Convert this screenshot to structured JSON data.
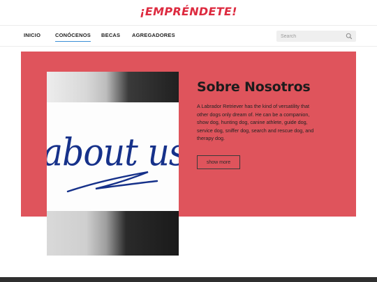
{
  "brand": {
    "logo_text": "¡EMPRÉNDETE!"
  },
  "colors": {
    "accent": "#dd2a3f",
    "hero_bg": "#df545c",
    "active_underline": "#3a8fd6"
  },
  "nav": {
    "items": [
      {
        "label": "INICIO"
      },
      {
        "label": "CONÓCENOS",
        "active": true
      },
      {
        "label": "BECAS"
      },
      {
        "label": "AGREGADORES"
      }
    ]
  },
  "search": {
    "placeholder": "Search",
    "icon": "search-icon"
  },
  "hero": {
    "image_text": "about us",
    "title": "Sobre Nosotros",
    "body": "A Labrador Retriever has the kind of versatility that other dogs only dream of. He can be a companion, show dog, hunting dog, canine athlete, guide dog, service dog, sniffer dog, search and rescue dog, and therapy dog.",
    "button_label": "show more"
  }
}
